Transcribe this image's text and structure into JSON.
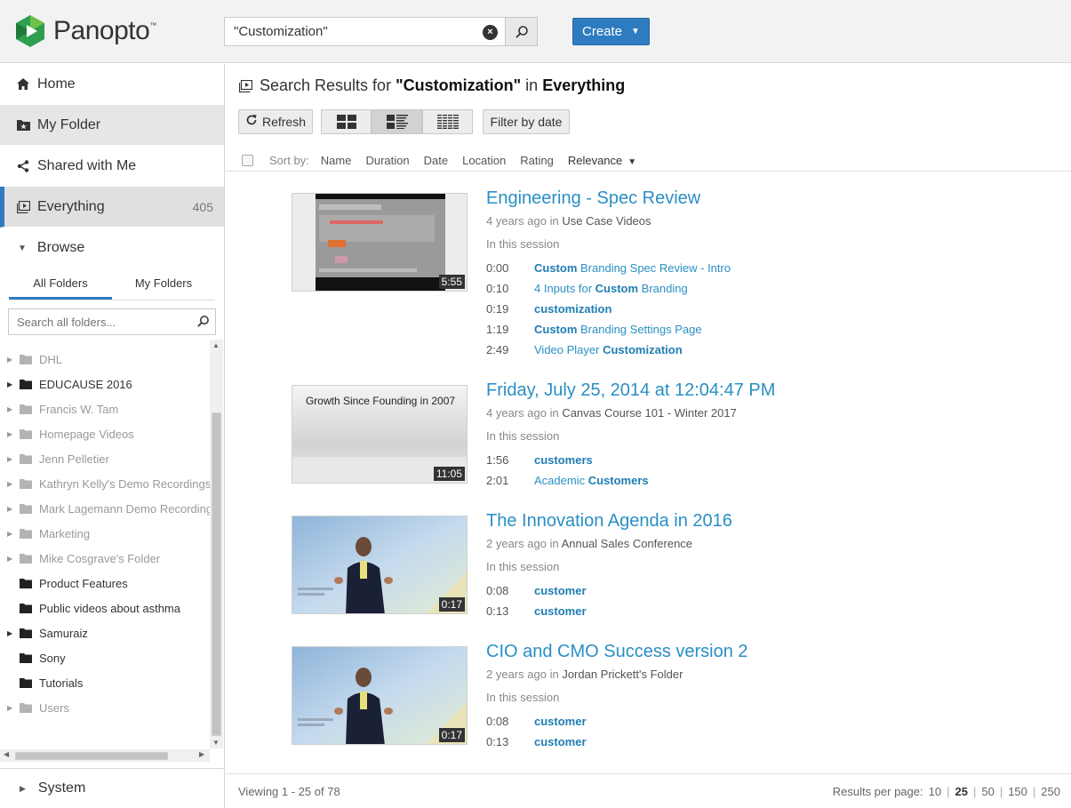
{
  "header": {
    "logo_text": "Panopto",
    "search_value": "\"Customization\"",
    "create_label": "Create"
  },
  "sidebar": {
    "nav": [
      {
        "label": "Home",
        "icon": "home-icon"
      },
      {
        "label": "My Folder",
        "icon": "my-folder-icon"
      },
      {
        "label": "Shared with Me",
        "icon": "share-icon"
      },
      {
        "label": "Everything",
        "icon": "everything-icon",
        "count": "405"
      }
    ],
    "browse_label": "Browse",
    "folder_tabs": [
      "All Folders",
      "My Folders"
    ],
    "folder_search_placeholder": "Search all folders...",
    "folders": [
      {
        "name": "DHL",
        "dim": true,
        "expandable": true
      },
      {
        "name": "EDUCAUSE 2016",
        "dim": false,
        "expandable": true
      },
      {
        "name": "Francis W. Tam",
        "dim": true,
        "expandable": true
      },
      {
        "name": "Homepage Videos",
        "dim": true,
        "expandable": true
      },
      {
        "name": "Jenn Pelletier",
        "dim": true,
        "expandable": true
      },
      {
        "name": "Kathryn Kelly's Demo Recordings",
        "dim": true,
        "expandable": true
      },
      {
        "name": "Mark Lagemann Demo Recordings",
        "dim": true,
        "expandable": true
      },
      {
        "name": "Marketing",
        "dim": true,
        "expandable": true
      },
      {
        "name": "Mike Cosgrave's Folder",
        "dim": true,
        "expandable": true
      },
      {
        "name": "Product Features",
        "dim": false,
        "expandable": false
      },
      {
        "name": "Public videos about asthma",
        "dim": false,
        "expandable": false
      },
      {
        "name": "Samuraiz",
        "dim": false,
        "expandable": true
      },
      {
        "name": "Sony",
        "dim": false,
        "expandable": false
      },
      {
        "name": "Tutorials",
        "dim": false,
        "expandable": false
      },
      {
        "name": "Users",
        "dim": true,
        "expandable": true
      }
    ],
    "system_label": "System"
  },
  "main": {
    "title_prefix": "Search Results for",
    "title_query": "\"Customization\"",
    "title_in": "in",
    "title_scope": "Everything",
    "toolbar": {
      "refresh_label": "Refresh",
      "filter_label": "Filter by date"
    },
    "sort": {
      "label": "Sort by:",
      "options": [
        "Name",
        "Duration",
        "Date",
        "Location",
        "Rating",
        "Relevance"
      ],
      "selected": "Relevance"
    },
    "in_session_label": "In this session",
    "results": [
      {
        "title": "Engineering - Spec Review",
        "age": "4 years ago",
        "in": "in",
        "location": "Use Case Videos",
        "duration": "5:55",
        "thumb": "screen",
        "hits": [
          {
            "time": "0:00",
            "parts": [
              [
                "Custom",
                true
              ],
              [
                " Branding Spec Review - Intro",
                false
              ]
            ]
          },
          {
            "time": "0:10",
            "parts": [
              [
                "4 Inputs for ",
                false
              ],
              [
                "Custom",
                true
              ],
              [
                " Branding",
                false
              ]
            ]
          },
          {
            "time": "0:19",
            "parts": [
              [
                "customization",
                true
              ]
            ]
          },
          {
            "time": "1:19",
            "parts": [
              [
                "Custom",
                true
              ],
              [
                " Branding Settings Page",
                false
              ]
            ]
          },
          {
            "time": "2:49",
            "parts": [
              [
                "Video Player ",
                false
              ],
              [
                "Customization",
                true
              ]
            ]
          }
        ]
      },
      {
        "title": "Friday, July 25, 2014 at 12:04:47 PM",
        "age": "4 years ago",
        "in": "in",
        "location": "Canvas Course 101 - Winter 2017",
        "duration": "11:05",
        "thumb": "slide",
        "slide_text": "Growth Since Founding in 2007",
        "hits": [
          {
            "time": "1:56",
            "parts": [
              [
                "customers",
                true
              ]
            ]
          },
          {
            "time": "2:01",
            "parts": [
              [
                "Academic ",
                false
              ],
              [
                "Customers",
                true
              ]
            ]
          }
        ]
      },
      {
        "title": "The Innovation Agenda in 2016",
        "age": "2 years ago",
        "in": "in",
        "location": "Annual Sales Conference",
        "duration": "0:17",
        "thumb": "speaker",
        "hits": [
          {
            "time": "0:08",
            "parts": [
              [
                "customer",
                true
              ]
            ]
          },
          {
            "time": "0:13",
            "parts": [
              [
                "customer",
                true
              ]
            ]
          }
        ]
      },
      {
        "title": "CIO and CMO Success version 2",
        "age": "2 years ago",
        "in": "in",
        "location": "Jordan Prickett's Folder",
        "duration": "0:17",
        "thumb": "speaker",
        "hits": [
          {
            "time": "0:08",
            "parts": [
              [
                "customer",
                true
              ]
            ]
          },
          {
            "time": "0:13",
            "parts": [
              [
                "customer",
                true
              ]
            ]
          }
        ]
      }
    ],
    "footer": {
      "viewing": "Viewing 1 - 25 of 78",
      "per_page_label": "Results per page:",
      "per_page_options": [
        "10",
        "25",
        "50",
        "150",
        "250"
      ],
      "per_page_selected": "25"
    }
  },
  "colors": {
    "accent": "#2f7bbf",
    "link": "#2a8fc4",
    "logo_green": "#3aa655"
  }
}
